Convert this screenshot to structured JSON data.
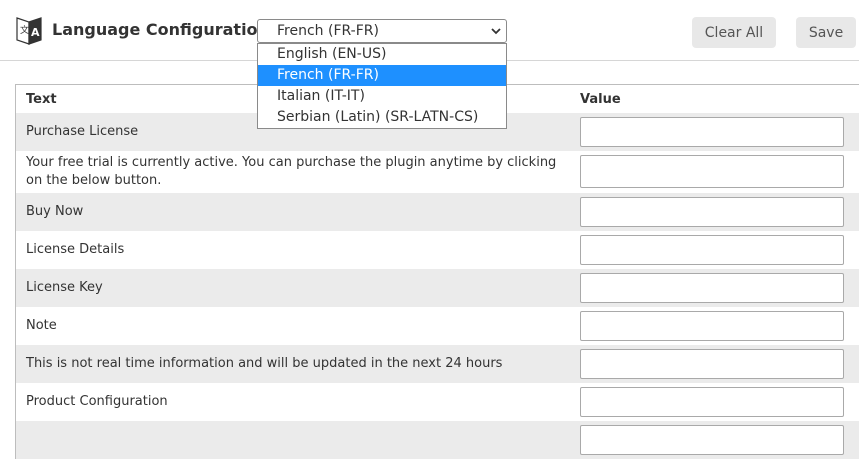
{
  "header": {
    "title": "Language Configuration",
    "icon": "translate-icon",
    "language_select": {
      "selected": "French (FR-FR)",
      "options": [
        "English (EN-US)",
        "French (FR-FR)",
        "Italian (IT-IT)",
        "Serbian (Latin) (SR-LATN-CS)"
      ]
    },
    "clear_all_label": "Clear All",
    "save_label": "Save"
  },
  "table": {
    "columns": [
      "Text",
      "Value"
    ],
    "rows": [
      {
        "text": "Purchase License",
        "value": ""
      },
      {
        "text": "Your free trial is currently active. You can purchase the plugin anytime by clicking on the below button.",
        "value": ""
      },
      {
        "text": "Buy Now",
        "value": ""
      },
      {
        "text": "License Details",
        "value": ""
      },
      {
        "text": "License Key",
        "value": ""
      },
      {
        "text": "Note",
        "value": ""
      },
      {
        "text": "This is not real time information and will be updated in the next 24 hours",
        "value": ""
      },
      {
        "text": "Product Configuration",
        "value": ""
      },
      {
        "text": "",
        "value": ""
      }
    ]
  },
  "colors": {
    "selected_option": "#1e90ff",
    "row_alt": "#ebebeb",
    "button_bg": "#e8e8e8"
  }
}
